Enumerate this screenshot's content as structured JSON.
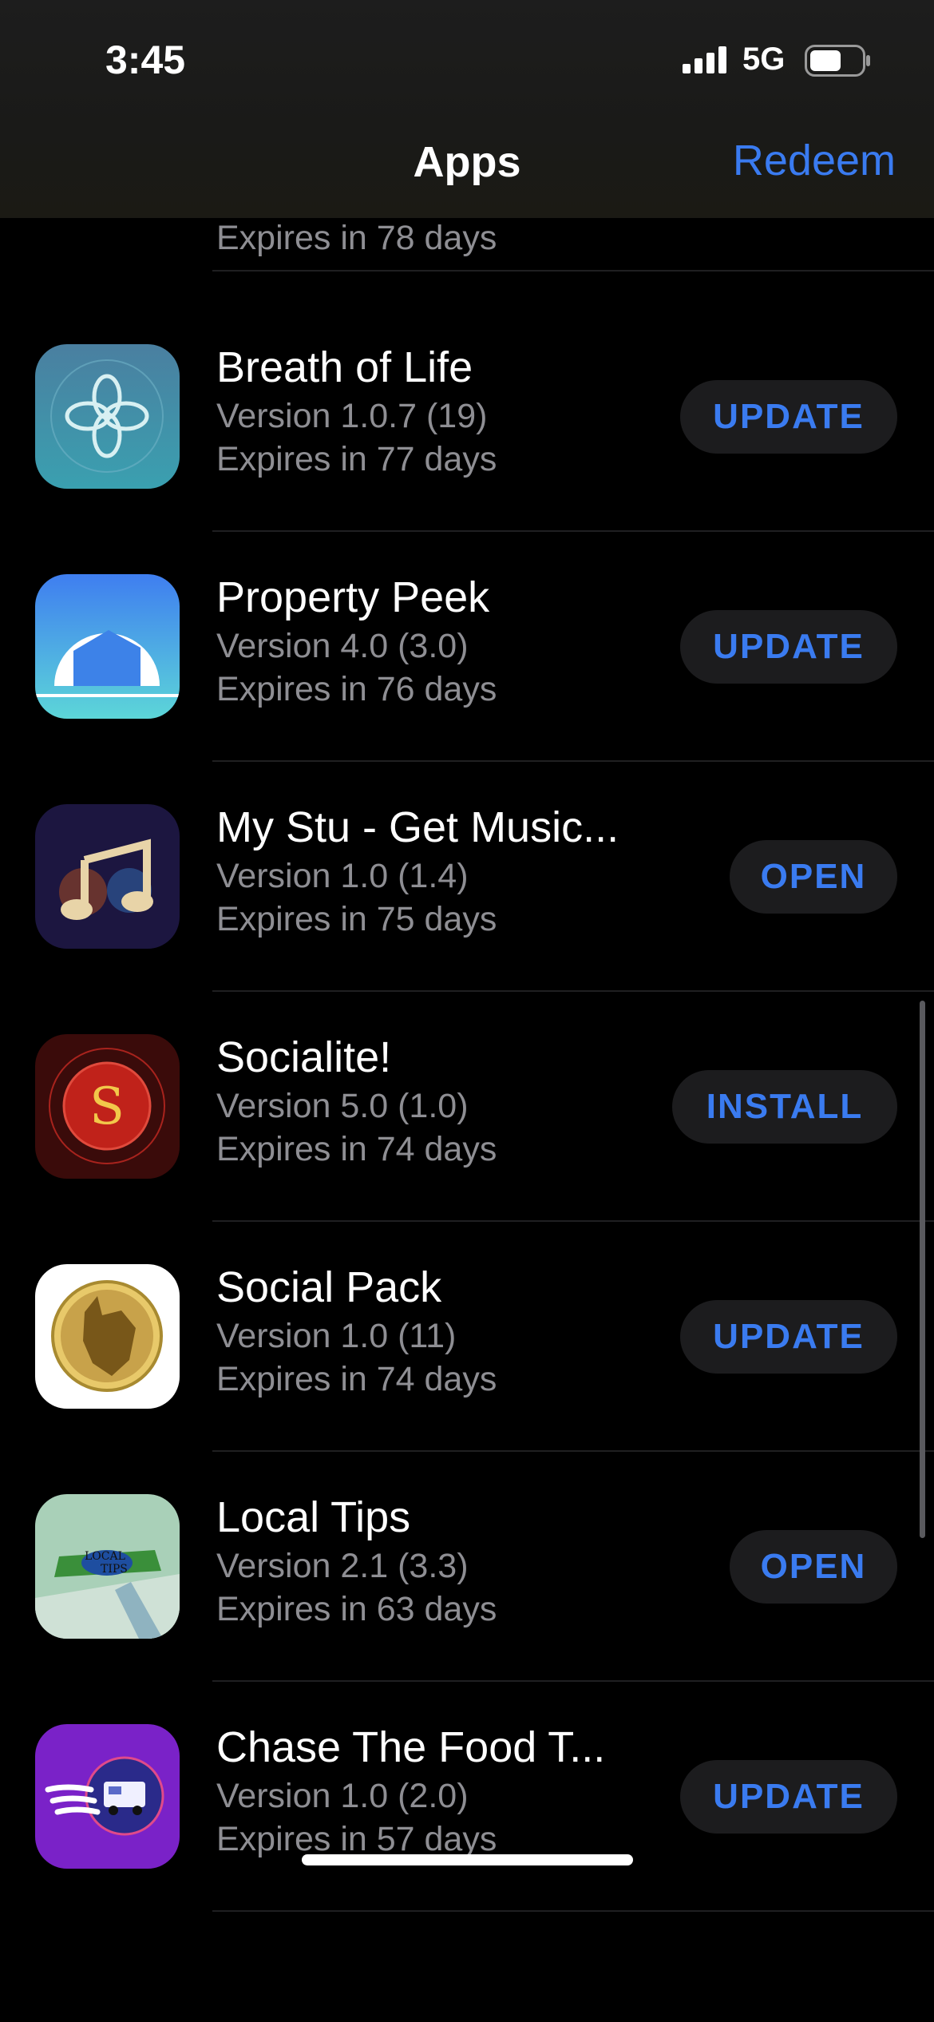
{
  "status_bar": {
    "time": "3:45",
    "network": "5G"
  },
  "nav": {
    "title": "Apps",
    "redeem_label": "Redeem"
  },
  "partial_row": {
    "expires": "Expires in 78 days"
  },
  "apps": [
    {
      "name": "Breath of Life",
      "version": "Version 1.0.7 (19)",
      "expires": "Expires in 77 days",
      "action": "UPDATE",
      "icon": "breath-of-life-icon"
    },
    {
      "name": "Property Peek",
      "version": "Version 4.0 (3.0)",
      "expires": "Expires in 76 days",
      "action": "UPDATE",
      "icon": "property-peek-icon"
    },
    {
      "name": "My Stu - Get Music...",
      "version": "Version 1.0 (1.4)",
      "expires": "Expires in 75 days",
      "action": "OPEN",
      "icon": "music-note-icon"
    },
    {
      "name": "Socialite!",
      "version": "Version 5.0 (1.0)",
      "expires": "Expires in 74 days",
      "action": "INSTALL",
      "icon": "socialite-icon"
    },
    {
      "name": "Social Pack",
      "version": "Version 1.0 (11)",
      "expires": "Expires in 74 days",
      "action": "UPDATE",
      "icon": "wolf-icon"
    },
    {
      "name": "Local Tips",
      "version": "Version 2.1 (3.3)",
      "expires": "Expires in 63 days",
      "action": "OPEN",
      "icon": "local-tips-icon"
    },
    {
      "name": "Chase The Food T...",
      "version": "Version 1.0 (2.0)",
      "expires": "Expires in 57 days",
      "action": "UPDATE",
      "icon": "food-truck-icon"
    }
  ],
  "colors": {
    "accent": "#3a7bf0",
    "button_bg": "#1c1c1e",
    "secondary_text": "#8e8e93"
  }
}
